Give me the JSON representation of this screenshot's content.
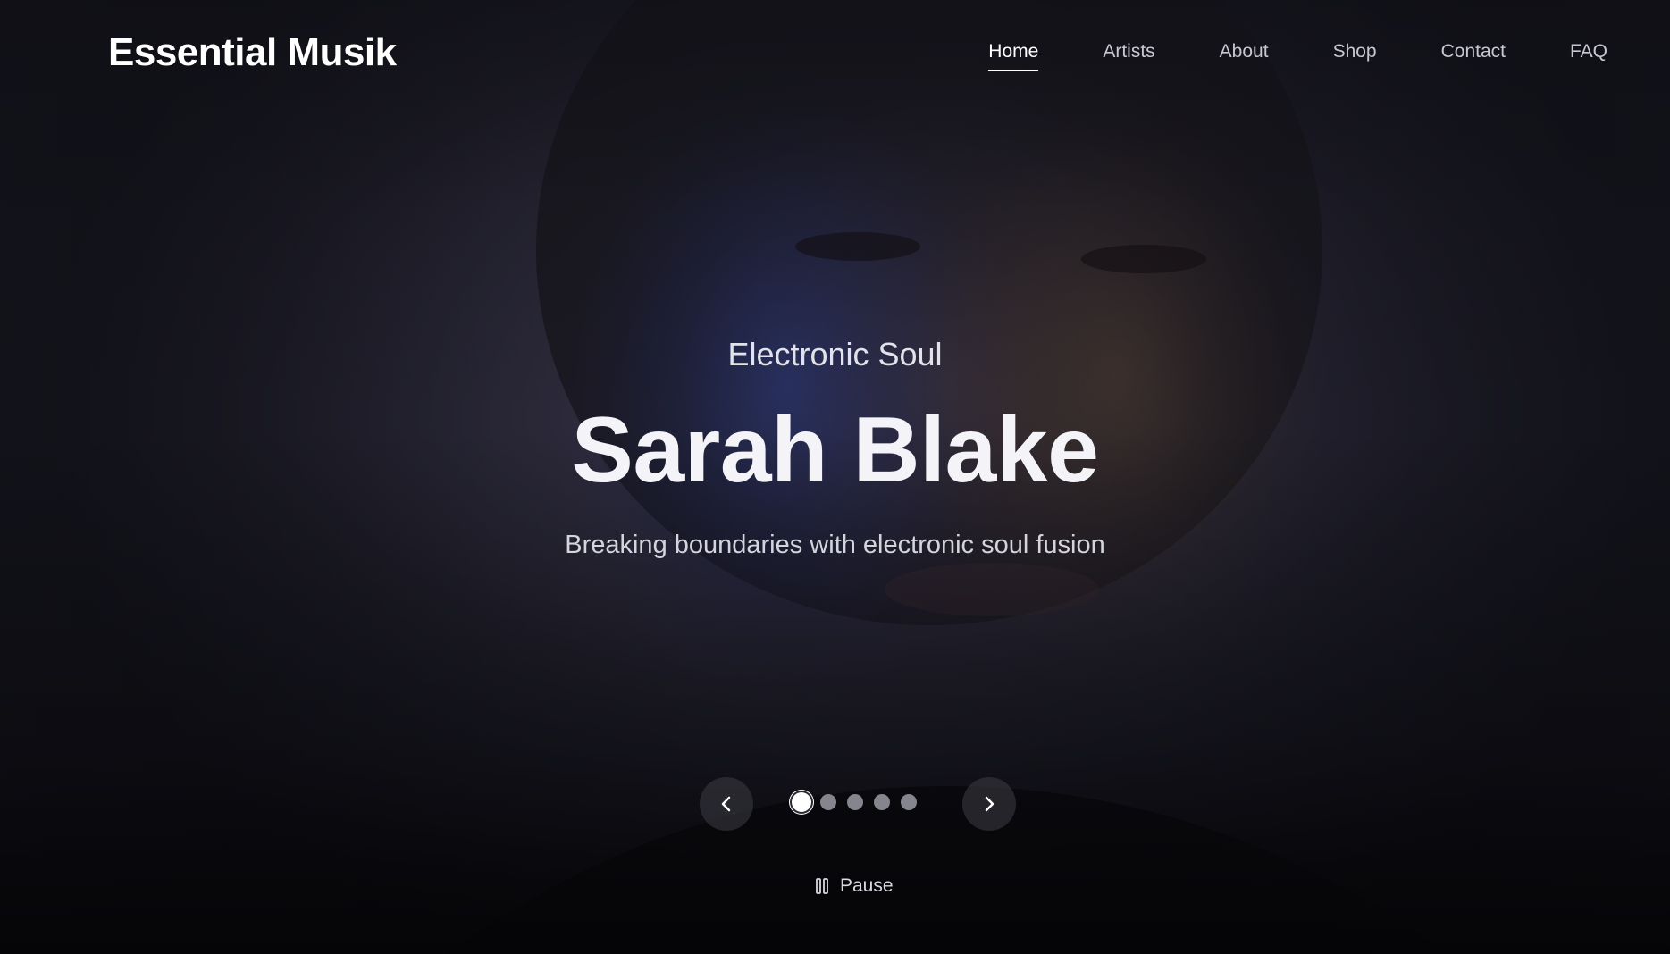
{
  "header": {
    "logo": "Essential Musik",
    "nav": [
      {
        "label": "Home",
        "active": true
      },
      {
        "label": "Artists",
        "active": false
      },
      {
        "label": "About",
        "active": false
      },
      {
        "label": "Shop",
        "active": false
      },
      {
        "label": "Contact",
        "active": false
      },
      {
        "label": "FAQ",
        "active": false
      }
    ]
  },
  "hero": {
    "genre": "Electronic Soul",
    "artist": "Sarah Blake",
    "tagline": "Breaking boundaries with electronic soul fusion"
  },
  "carousel": {
    "prev_icon": "chevron-left-icon",
    "next_icon": "chevron-right-icon",
    "slide_count": 5,
    "active_slide": 1,
    "pause_label": "Pause",
    "pause_icon": "pause-icon"
  },
  "colors": {
    "text": "#ffffff",
    "muted": "#c8c8d0",
    "dot_inactive": "#85858e"
  }
}
